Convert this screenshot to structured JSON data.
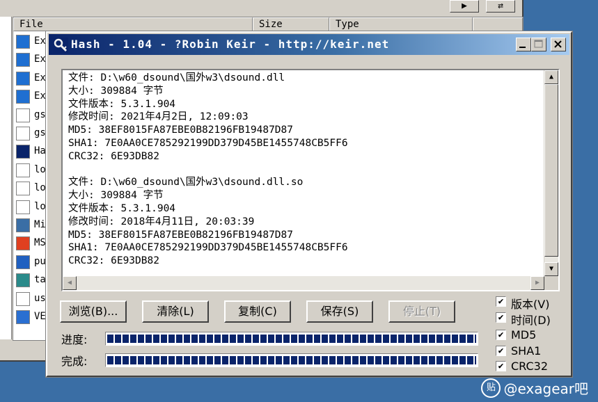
{
  "background_window": {
    "columns": [
      "File",
      "Size",
      "Type"
    ],
    "rows": [
      "Ex",
      "Ex",
      "Ex",
      "Ex",
      "gs",
      "gs",
      "Ha",
      "lo",
      "lo",
      "lo",
      "Mi",
      "MS",
      "pu",
      "ta",
      "us",
      "VE"
    ]
  },
  "dialog": {
    "title": "Hash - 1.04 - ?Robin Keir - http://keir.net",
    "output_lines": [
      "文件: D:\\w60_dsound\\国外w3\\dsound.dll",
      "大小: 309884 字节",
      "文件版本: 5.3.1.904",
      "修改时间: 2021年4月2日, 12:09:03",
      "MD5: 38EF8015FA87EBE0B82196FB19487D87",
      "SHA1: 7E0AA0CE785292199DD379D45BE1455748CB5FF6",
      "CRC32: 6E93DB82",
      "",
      "文件: D:\\w60_dsound\\国外w3\\dsound.dll.so",
      "大小: 309884 字节",
      "文件版本: 5.3.1.904",
      "修改时间: 2018年4月11日, 20:03:39",
      "MD5: 38EF8015FA87EBE0B82196FB19487D87",
      "SHA1: 7E0AA0CE785292199DD379D45BE1455748CB5FF6",
      "CRC32: 6E93DB82"
    ],
    "buttons": {
      "browse": "浏览(B)...",
      "clear": "清除(L)",
      "copy": "复制(C)",
      "save": "保存(S)",
      "stop": "停止(T)"
    },
    "progress_label": "进度:",
    "done_label": "完成:",
    "progress_fraction": 1.0,
    "done_fraction": 1.0,
    "checkboxes": [
      {
        "label": "版本(V)",
        "checked": true
      },
      {
        "label": "时间(D)",
        "checked": true
      },
      {
        "label": "MD5",
        "checked": true
      },
      {
        "label": "SHA1",
        "checked": true
      },
      {
        "label": "CRC32",
        "checked": true
      }
    ]
  },
  "watermark": "@exagear吧",
  "icons": {
    "title": "hash-app-icon",
    "minimize": "minimize-icon",
    "maximize": "maximize-icon",
    "close": "close-icon",
    "watermark": "tieba-icon"
  },
  "colors": {
    "desktop": "#3a6ea5",
    "titlebar_start": "#0a246a",
    "titlebar_end": "#a6caf0",
    "progress_fill": "#0a246a",
    "face": "#d4d0c8"
  }
}
